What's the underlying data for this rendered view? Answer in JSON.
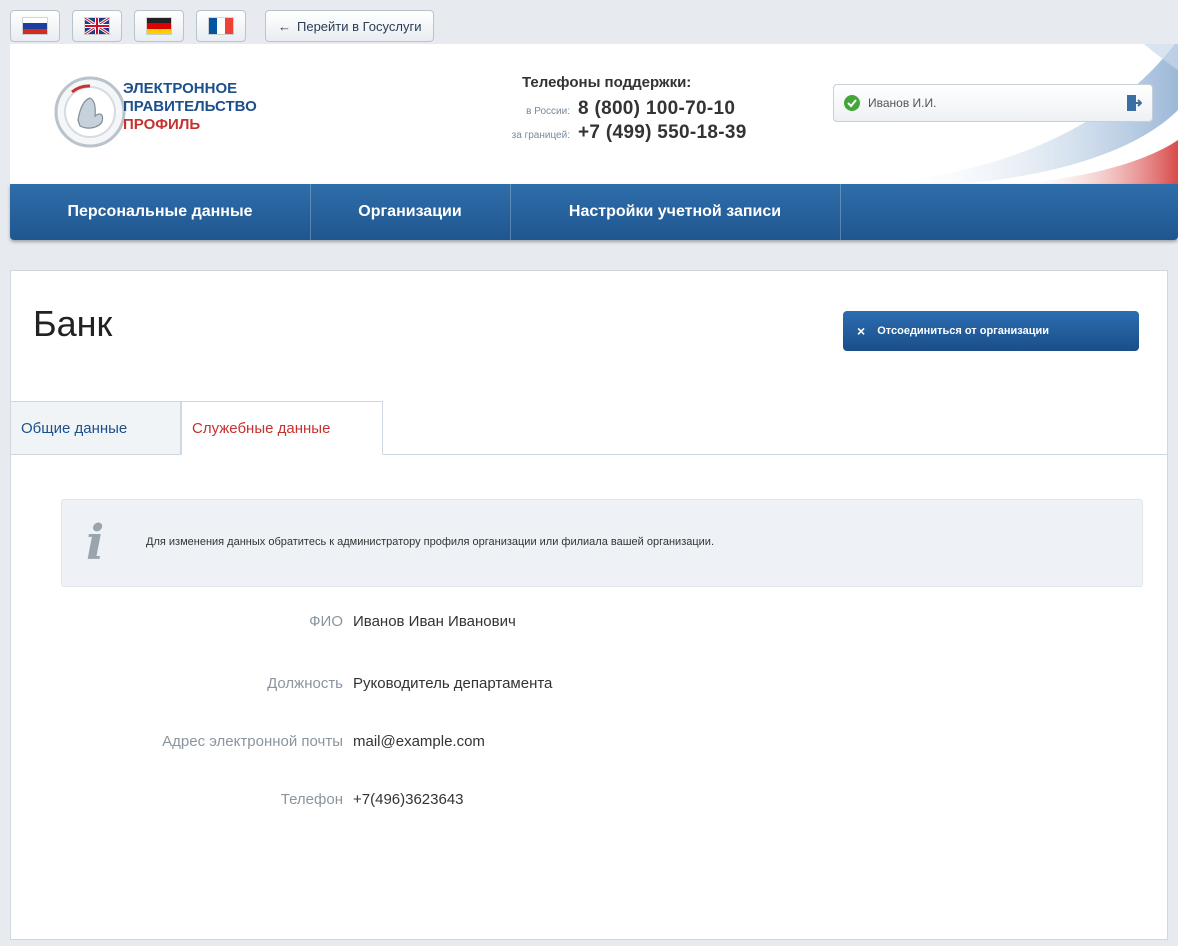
{
  "top": {
    "languages": [
      {
        "code": "ru",
        "name": "Русский"
      },
      {
        "code": "en",
        "name": "English"
      },
      {
        "code": "de",
        "name": "Deutsch"
      },
      {
        "code": "fr",
        "name": "Français"
      }
    ],
    "gosuslugi_label": "Перейти в Госуслуги",
    "gosuslugi_arrow": "←"
  },
  "header": {
    "logo_line1": "ЭЛЕКТРОННОЕ",
    "logo_line2": "ПРАВИТЕЛЬСТВО",
    "logo_line3": "ПРОФИЛЬ",
    "support_title": "Телефоны поддержки:",
    "phones": [
      {
        "caption": "в России:",
        "number": "8 (800) 100-70-10"
      },
      {
        "caption": "за границей:",
        "number": "+7 (499) 550-18-39"
      }
    ],
    "user_name": "Иванов И.И."
  },
  "nav": {
    "items": [
      "Персональные данные",
      "Организации",
      "Настройки учетной записи"
    ]
  },
  "main": {
    "title": "Банк",
    "disconnect_label": "Отсоединиться от организации",
    "disconnect_icon": "×",
    "tabs": [
      {
        "label": "Общие данные",
        "active": false
      },
      {
        "label": "Служебные данные",
        "active": true
      }
    ],
    "info_icon": "i",
    "notice": "Для изменения данных обратитесь к администратору профиля организации или филиала вашей организации.",
    "fields": [
      {
        "label": "ФИО",
        "value": "Иванов Иван Иванович"
      },
      {
        "label": "Должность",
        "value": "Руководитель департамента"
      },
      {
        "label": "Адрес электронной почты",
        "value": "mail@example.com"
      },
      {
        "label": "Телефон",
        "value": "+7(496)3623643"
      }
    ]
  },
  "colors": {
    "nav_blue": "#1f5690",
    "logo_blue": "#1d4f8c",
    "accent_red": "#c5322f",
    "status_green": "#43a53a"
  }
}
